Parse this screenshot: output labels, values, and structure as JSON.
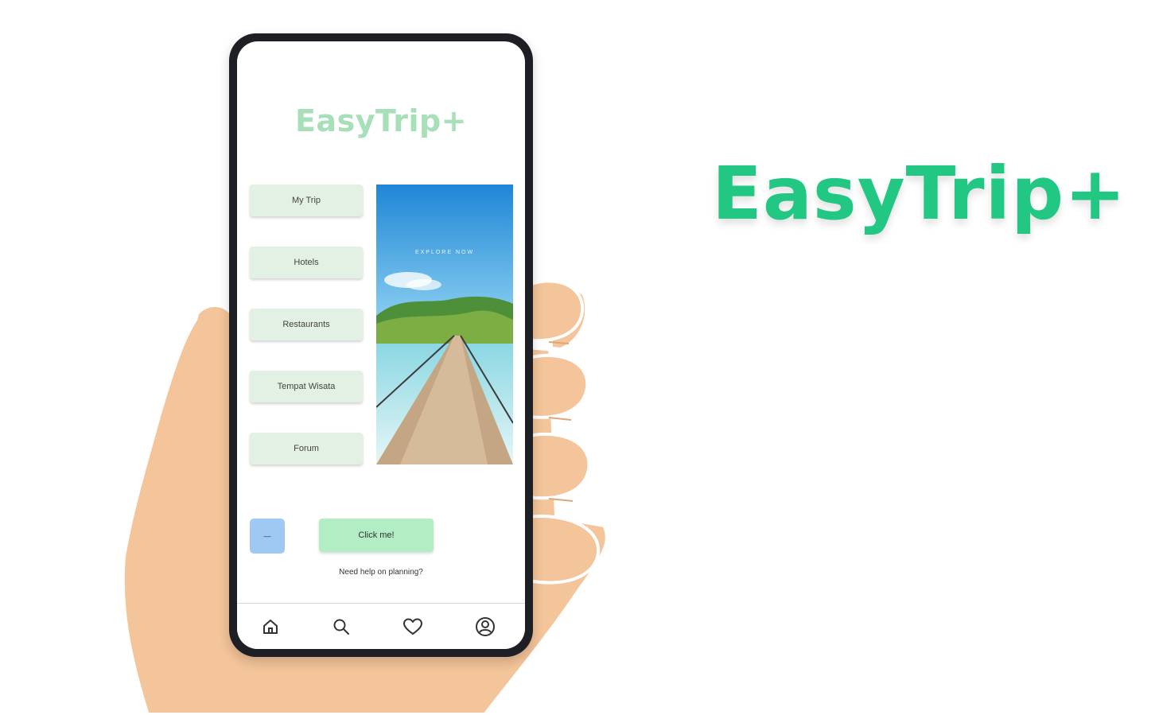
{
  "app": {
    "logo": "EasyTrip+",
    "menu": [
      {
        "label": "My Trip"
      },
      {
        "label": "Hotels"
      },
      {
        "label": "Restaurants"
      },
      {
        "label": "Tempat Wisata"
      },
      {
        "label": "Forum"
      }
    ],
    "hero_text": "EXPLORE NOW",
    "small_button_label": "—",
    "cta_label": "Click me!",
    "help_text": "Need help on planning?",
    "tabs": [
      {
        "icon": "home-icon"
      },
      {
        "icon": "search-icon"
      },
      {
        "icon": "heart-icon"
      },
      {
        "icon": "profile-icon"
      }
    ]
  },
  "brand_title": "EasyTrip+",
  "colors": {
    "brand_green": "#22c783",
    "app_logo_green": "#a6dfb8",
    "menu_button_bg": "#e3f0e4",
    "cta_bg": "#b3edc4",
    "small_button_bg": "#9fc8f2",
    "skin": "#f4c49a"
  }
}
